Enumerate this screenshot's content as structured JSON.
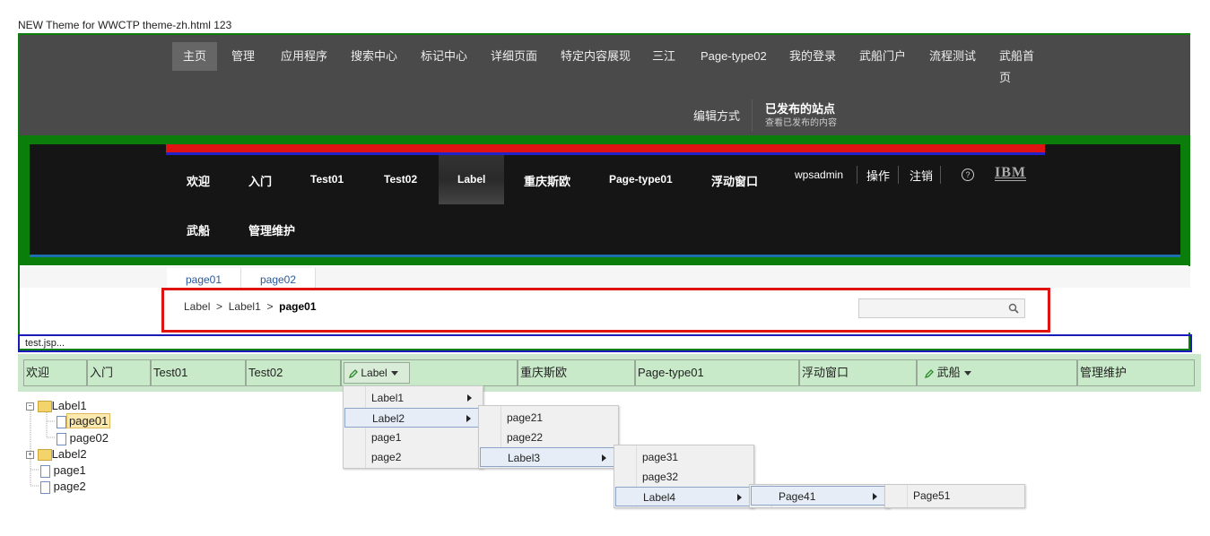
{
  "page_title": "NEW Theme for WWCTP theme-zh.html 123",
  "top_nav": {
    "items": [
      "主页",
      "管理",
      "应用程序",
      "搜索中心",
      "标记中心",
      "详细页面",
      "特定内容展现",
      "三江",
      "Page-type02",
      "我的登录",
      "武船门户",
      "流程测试",
      "武船首",
      "页"
    ],
    "edit_mode": "编辑方式",
    "published": "已发布的站点",
    "published_sub": "查看已发布的内容"
  },
  "black_nav": {
    "items": [
      "欢迎",
      "入门",
      "Test01",
      "Test02",
      "Label",
      "重庆斯欧",
      "Page-type01",
      "浮动窗口",
      "武船",
      "管理维护"
    ],
    "user": "wpsadmin",
    "actions": "操作",
    "logout": "注销",
    "help": "?",
    "logo": "IBM"
  },
  "page_tabs": [
    "page01",
    "page02"
  ],
  "breadcrumb": {
    "a": "Label",
    "sep": ">",
    "b": "Label1",
    "current": "page01"
  },
  "search": {
    "placeholder": ""
  },
  "test_jsp": "test.jsp...",
  "menubar": {
    "items": [
      "欢迎",
      "入门",
      "Test01",
      "Test02",
      "Label",
      "重庆斯欧",
      "Page-type01",
      "浮动窗口",
      "武船",
      "管理维护"
    ]
  },
  "menu1": [
    "Label1",
    "Label2",
    "page1",
    "page2"
  ],
  "menu2": [
    "page21",
    "page22",
    "Label3"
  ],
  "menu3": [
    "page31",
    "page32",
    "Label4"
  ],
  "menu4": [
    "Page41"
  ],
  "menu5": [
    "Page51"
  ],
  "tree": {
    "label1": "Label1",
    "page01": "page01",
    "page02": "page02",
    "label2": "Label2",
    "page1": "page1",
    "page2": "page2"
  }
}
